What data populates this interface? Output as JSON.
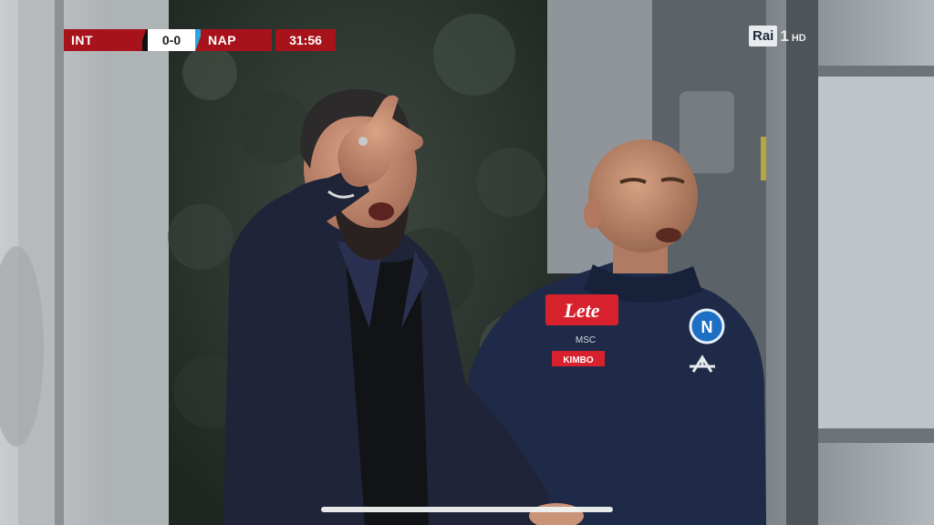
{
  "scorebug": {
    "home_team": "INT",
    "score": "0-0",
    "away_team": "NAP",
    "clock": "31:56"
  },
  "broadcaster": {
    "channel": "Rai",
    "number": "1",
    "quality": "HD"
  },
  "jacket": {
    "sponsor": "Lete",
    "badge": "N",
    "tag_small": "MSC",
    "tag_second": "KIMBO"
  },
  "colors": {
    "scorebug_red": "#a8121a",
    "napoli_blue": "#1a2a4d",
    "background_gray": "#9aa0a6"
  }
}
